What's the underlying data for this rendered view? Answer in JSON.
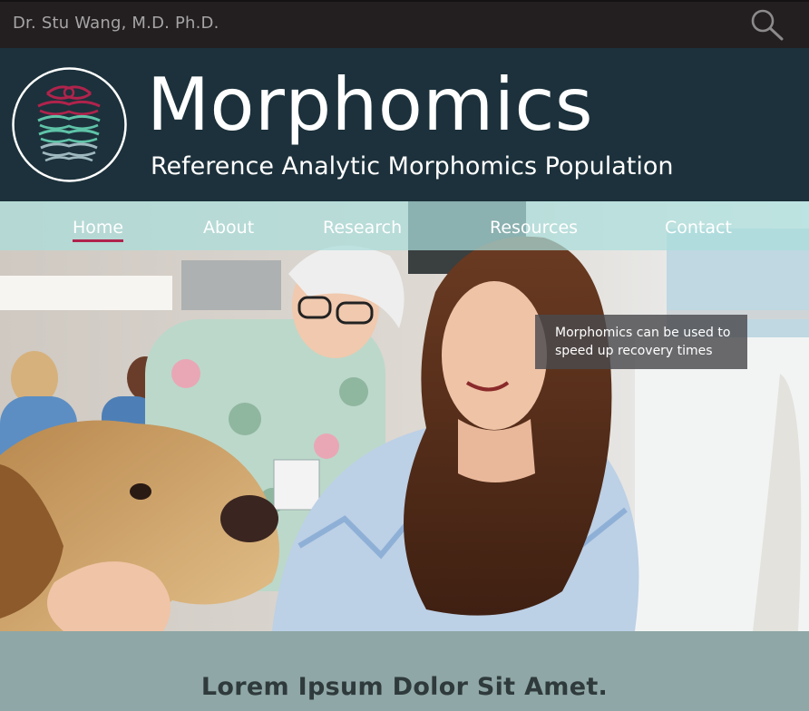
{
  "topbar": {
    "author": "Dr. Stu Wang, M.D. Ph.D.",
    "search_icon": "search-icon"
  },
  "header": {
    "title": "Morphomics",
    "subtitle": "Reference Analytic Morphomics Population",
    "logo_icon": "spine-logo-icon"
  },
  "nav": {
    "items": [
      {
        "label": "Home",
        "active": true
      },
      {
        "label": "About"
      },
      {
        "label": "Research"
      },
      {
        "label": "Resources"
      },
      {
        "label": "Contact"
      }
    ]
  },
  "hero": {
    "image": "nurse-patient-therapy-dog-photo",
    "callout": "Morphomics can be used to speed up recovery times"
  },
  "section": {
    "heading": "Lorem Ipsum Dolor Sit Amet."
  },
  "colors": {
    "topbar": "#231f20",
    "header": "#1c313b",
    "nav_overlay": "#aadedb",
    "active_underline": "#b0234c",
    "section_bg": "#8fa7a6",
    "logo_red": "#b0234c",
    "logo_teal": "#5fc3a8"
  }
}
